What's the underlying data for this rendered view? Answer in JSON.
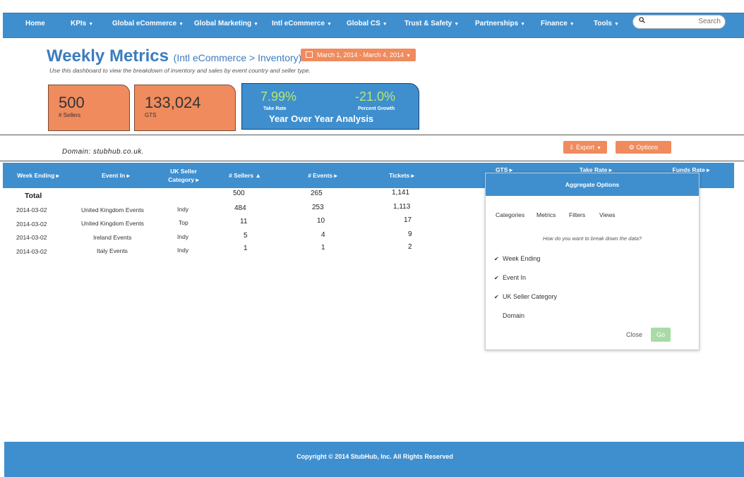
{
  "nav": {
    "items": [
      {
        "label": "Home",
        "dropdown": false
      },
      {
        "label": "KPIs",
        "dropdown": true
      },
      {
        "label": "Global eCommerce",
        "dropdown": true
      },
      {
        "label": "Global Marketing",
        "dropdown": true
      },
      {
        "label": "Intl eCommerce",
        "dropdown": true
      },
      {
        "label": "Global CS",
        "dropdown": true
      },
      {
        "label": "Trust & Safety",
        "dropdown": true
      },
      {
        "label": "Partnerships",
        "dropdown": true
      },
      {
        "label": "Finance",
        "dropdown": true
      },
      {
        "label": "Tools",
        "dropdown": true
      }
    ],
    "caret": "▼",
    "search_placeholder": "Search"
  },
  "header": {
    "title": "Weekly Metrics",
    "subtitle": "(Intl eCommerce > Inventory)",
    "date_range": "March 1, 2014 - March 4, 2014",
    "description": "Use this dashboard to view the breakdown of inventory and sales by event country and seller type."
  },
  "kpis": {
    "sellers": {
      "value": "500",
      "label": "# Sellers"
    },
    "gts": {
      "value": "133,024",
      "label": "GTS"
    },
    "yoy": {
      "take_rate": {
        "value": "7.99%",
        "label": "Take Rate"
      },
      "growth": {
        "value": "-21.0%",
        "label": "Percent Growth"
      },
      "title": "Year Over Year Analysis"
    }
  },
  "domain_label": "Domain: stubhub.co.uk.",
  "toolbar": {
    "export_label": "Export",
    "options_label": "Options"
  },
  "table": {
    "columns": [
      "Week Ending",
      "Event In",
      "UK Seller Category",
      "# Sellers",
      "# Events",
      "Tickets",
      "GTS",
      "Take Rate",
      "Funds Rate"
    ],
    "total": {
      "label": "Total",
      "sellers": "500",
      "events": "265",
      "tickets": "1,141"
    },
    "rows": [
      {
        "week": "2014-03-02",
        "event_in": "United Kingdom Events",
        "category": "Indy",
        "sellers": "484",
        "events": "253",
        "tickets": "1,113"
      },
      {
        "week": "2014-03-02",
        "event_in": "United Kingdom Events",
        "category": "Top",
        "sellers": "11",
        "events": "10",
        "tickets": "17"
      },
      {
        "week": "2014-03-02",
        "event_in": "Ireland Events",
        "category": "Indy",
        "sellers": "5",
        "events": "4",
        "tickets": "9"
      },
      {
        "week": "2014-03-02",
        "event_in": "Italy Events",
        "category": "Indy",
        "sellers": "1",
        "events": "1",
        "tickets": "2"
      }
    ]
  },
  "modal": {
    "title": "Aggregate Options",
    "tabs": [
      "Categories",
      "Metrics",
      "Filters",
      "Views"
    ],
    "question": "How do you want to break down the data?",
    "options": [
      {
        "label": "Week Ending",
        "checked": true
      },
      {
        "label": "Event In",
        "checked": true
      },
      {
        "label": "UK Seller Category",
        "checked": true
      },
      {
        "label": "Domain",
        "checked": false
      }
    ],
    "close_label": "Close",
    "go_label": "Go"
  },
  "footer": {
    "copyright": "Copyright © 2014 StubHub, Inc. All Rights Reserved"
  },
  "colors": {
    "nav_blue": "#3f8fcf",
    "accent_orange": "#f08b5e",
    "title_blue": "#3b7cbf",
    "yoy_green": "#b6e86d",
    "go_green": "#a8dba5"
  }
}
